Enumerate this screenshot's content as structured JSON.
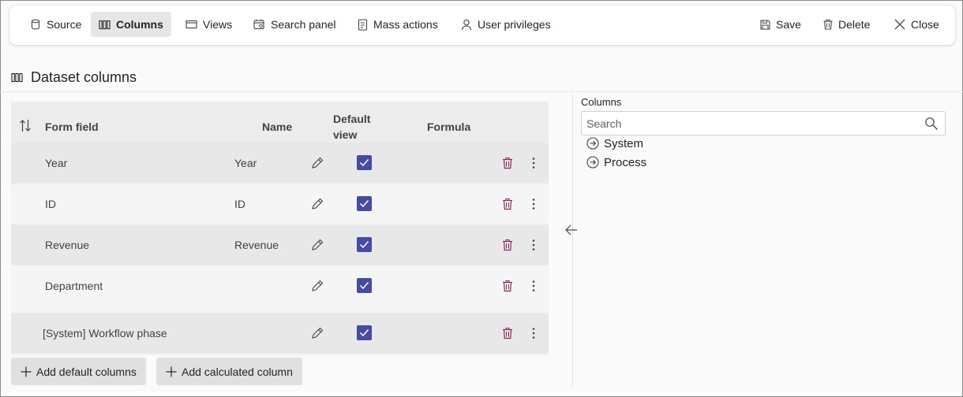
{
  "toolbar": {
    "left": [
      {
        "label": "Source",
        "icon": "database-icon"
      },
      {
        "label": "Columns",
        "icon": "columns-icon",
        "active": true
      },
      {
        "label": "Views",
        "icon": "views-icon"
      },
      {
        "label": "Search panel",
        "icon": "search-panel-icon"
      },
      {
        "label": "Mass actions",
        "icon": "mass-actions-icon"
      },
      {
        "label": "User privileges",
        "icon": "user-icon"
      }
    ],
    "right": [
      {
        "label": "Save",
        "icon": "save-icon"
      },
      {
        "label": "Delete",
        "icon": "delete-icon"
      },
      {
        "label": "Close",
        "icon": "close-icon"
      }
    ]
  },
  "section": {
    "title": "Dataset columns"
  },
  "table": {
    "headers": {
      "form_field": "Form field",
      "name": "Name",
      "default_view_line1": "Default",
      "default_view_line2": "view",
      "formula": "Formula"
    },
    "rows": [
      {
        "form_field": "Year",
        "name": "Year",
        "default_view": true,
        "formula": ""
      },
      {
        "form_field": "ID",
        "name": "ID",
        "default_view": true,
        "formula": ""
      },
      {
        "form_field": "Revenue",
        "name": "Revenue",
        "default_view": true,
        "formula": ""
      },
      {
        "form_field": "Department",
        "name": "",
        "default_view": true,
        "formula": ""
      },
      {
        "form_field": "[System] Workflow phase",
        "name": "",
        "default_view": true,
        "formula": ""
      }
    ]
  },
  "actions": {
    "add_default": "Add default columns",
    "add_calculated": "Add calculated column"
  },
  "columns_panel": {
    "label": "Columns",
    "search_placeholder": "Search",
    "search_value": "",
    "items": [
      {
        "label": "System"
      },
      {
        "label": "Process"
      }
    ]
  },
  "colors": {
    "accent": "#464ba3",
    "toolbar_active": "#e6e6e6",
    "delete_icon": "#8a2a5a"
  }
}
